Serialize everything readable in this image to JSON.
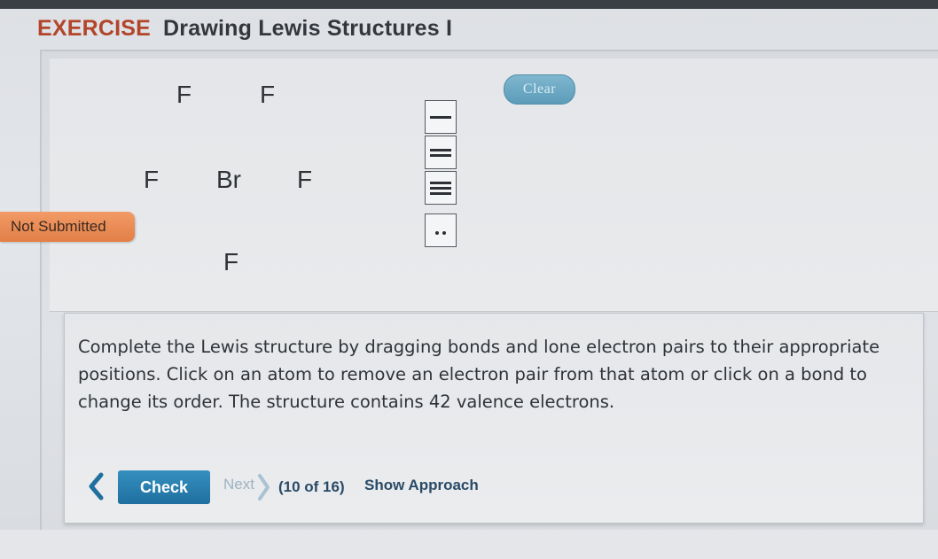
{
  "header": {
    "prefix": "EXERCISE",
    "title": "Drawing Lewis Structures I"
  },
  "status_badge": "Not Submitted",
  "canvas": {
    "atoms": [
      "F",
      "F",
      "F",
      "Br",
      "F",
      "F"
    ],
    "clear_label": "Clear",
    "tools": [
      "single-bond",
      "double-bond",
      "triple-bond",
      "lone-pair"
    ]
  },
  "instructions": "Complete the Lewis structure by dragging bonds and lone electron pairs to their appropriate positions. Click on an atom to remove an electron pair from that atom or click on a bond to change its order. The structure contains 42 valence electrons.",
  "nav": {
    "check_label": "Check",
    "next_label": "Next",
    "counter": "(10 of 16)",
    "approach_label": "Show Approach"
  },
  "colors": {
    "accent": "#1f6f9f",
    "badge": "#e8874f",
    "header_prefix": "#b2452a"
  }
}
